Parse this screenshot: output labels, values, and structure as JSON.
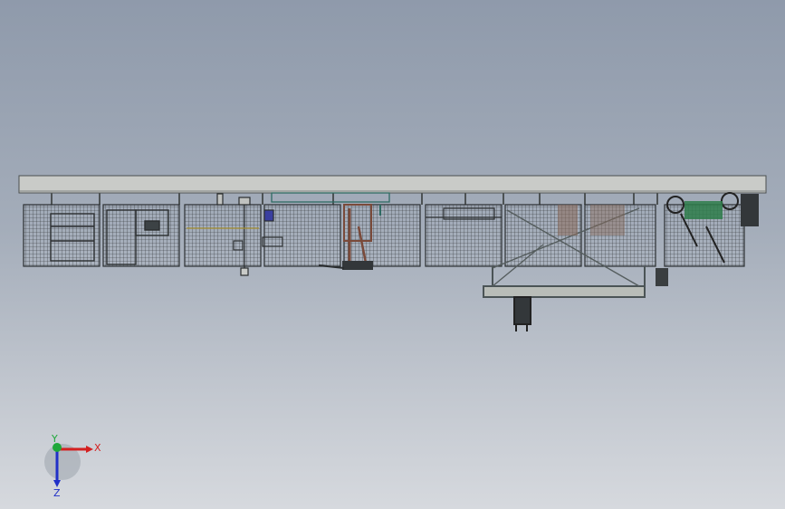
{
  "viewport": {
    "background_top": "#8f9aab",
    "background_bottom": "#d6d9de"
  },
  "model": {
    "beam_color": "#c9cbc8",
    "beam_edge": "#4b4f4f",
    "fence_stroke": "#3a3e40",
    "machine_accent": "#2e7d4a",
    "robot_color": "#7a4a3a"
  },
  "triad": {
    "x_label": "X",
    "y_label": "Y",
    "z_label": "Z",
    "x_color": "#d42020",
    "y_color": "#1fa83a",
    "z_color": "#2030c8"
  }
}
